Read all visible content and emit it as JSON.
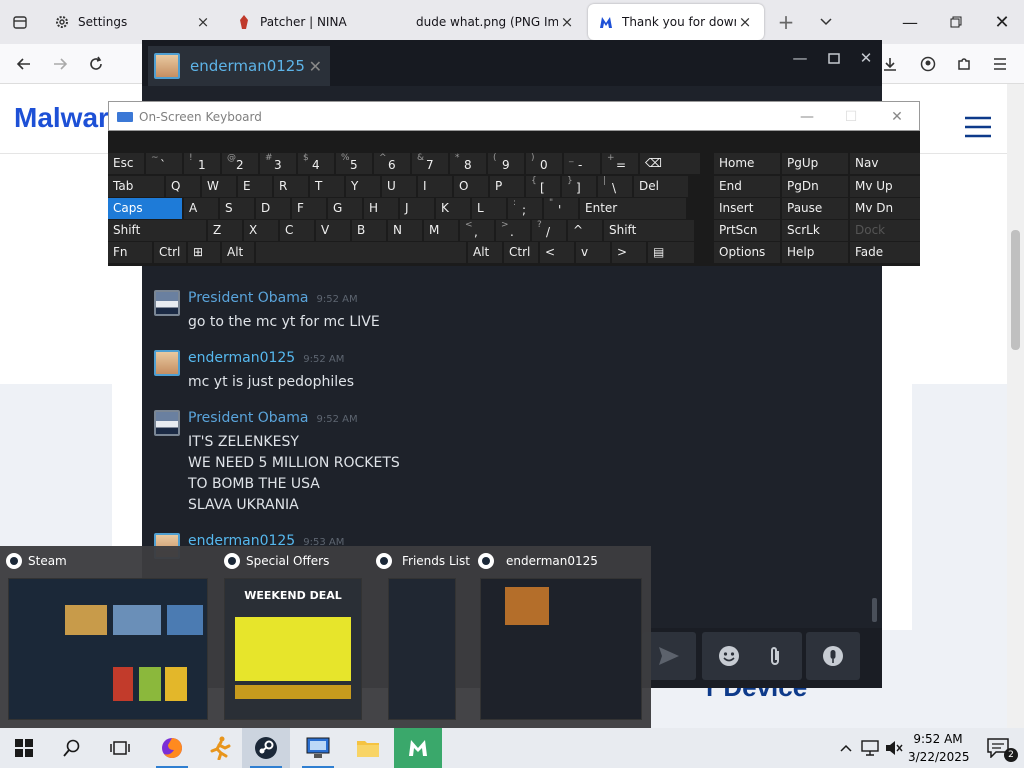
{
  "browser": {
    "tabs": [
      {
        "label": "Settings",
        "icon": "gear-icon"
      },
      {
        "label": "Patcher | NINA",
        "icon": "app-icon"
      },
      {
        "label": "dude what.png (PNG Imag",
        "icon": "image-icon"
      },
      {
        "label": "Thank you for downloa",
        "icon": "malwarebytes-icon"
      }
    ]
  },
  "website": {
    "logo_text": "Malwar",
    "device_heading": "r Device"
  },
  "steam_chat": {
    "tab_name": "enderman0125",
    "messages": [
      {
        "sender": "President Obama",
        "time": "9:52 AM",
        "lines": [
          "go to the mc yt for mc LIVE"
        ],
        "kind": "obama"
      },
      {
        "sender": "enderman0125",
        "time": "9:52 AM",
        "lines": [
          "mc yt is just pedophiles"
        ],
        "kind": "ender"
      },
      {
        "sender": "President Obama",
        "time": "9:52 AM",
        "lines": [
          "IT'S ZELENKESY",
          "WE NEED 5 MILLION ROCKETS",
          "TO BOMB THE USA",
          "SLAVA UKRANIA"
        ],
        "kind": "obama"
      },
      {
        "sender": "enderman0125",
        "time": "9:53 AM",
        "lines": [],
        "kind": "ender"
      }
    ]
  },
  "osk": {
    "title": "On-Screen Keyboard",
    "rows": [
      [
        [
          "Esc",
          ""
        ],
        [
          "`",
          "~"
        ],
        [
          "1",
          "!"
        ],
        [
          "2",
          "@"
        ],
        [
          "3",
          "#"
        ],
        [
          "4",
          "$"
        ],
        [
          "5",
          "%"
        ],
        [
          "6",
          "^"
        ],
        [
          "7",
          "&"
        ],
        [
          "8",
          "*"
        ],
        [
          "9",
          "("
        ],
        [
          "0",
          ")"
        ],
        [
          "-",
          "_"
        ],
        [
          "=",
          "+"
        ],
        [
          "⌫",
          ""
        ]
      ],
      [
        [
          "Tab",
          ""
        ],
        [
          "Q",
          ""
        ],
        [
          "W",
          ""
        ],
        [
          "E",
          ""
        ],
        [
          "R",
          ""
        ],
        [
          "T",
          ""
        ],
        [
          "Y",
          ""
        ],
        [
          "U",
          ""
        ],
        [
          "I",
          ""
        ],
        [
          "O",
          ""
        ],
        [
          "P",
          ""
        ],
        [
          "[",
          "{"
        ],
        [
          "]",
          "}"
        ],
        [
          "\\",
          "|"
        ],
        [
          "Del",
          ""
        ]
      ],
      [
        [
          "Caps",
          ""
        ],
        [
          "A",
          ""
        ],
        [
          "S",
          ""
        ],
        [
          "D",
          ""
        ],
        [
          "F",
          ""
        ],
        [
          "G",
          ""
        ],
        [
          "H",
          ""
        ],
        [
          "J",
          ""
        ],
        [
          "K",
          ""
        ],
        [
          "L",
          ""
        ],
        [
          ";",
          ":"
        ],
        [
          "'",
          "\""
        ],
        [
          "Enter",
          ""
        ]
      ],
      [
        [
          "Shift",
          ""
        ],
        [
          "Z",
          ""
        ],
        [
          "X",
          ""
        ],
        [
          "C",
          ""
        ],
        [
          "V",
          ""
        ],
        [
          "B",
          ""
        ],
        [
          "N",
          ""
        ],
        [
          "M",
          ""
        ],
        [
          ",",
          "<"
        ],
        [
          ".",
          ">"
        ],
        [
          "/",
          "?"
        ],
        [
          "^",
          ""
        ],
        [
          "Shift",
          ""
        ]
      ],
      [
        [
          "Fn",
          ""
        ],
        [
          "Ctrl",
          ""
        ],
        [
          "⊞",
          ""
        ],
        [
          "Alt",
          ""
        ],
        [
          "",
          ""
        ],
        [
          "Alt",
          ""
        ],
        [
          "Ctrl",
          ""
        ],
        [
          "<",
          ""
        ],
        [
          "v",
          ""
        ],
        [
          ">",
          ""
        ],
        [
          "▤",
          ""
        ]
      ]
    ],
    "nav_keys": [
      [
        "Home",
        "PgUp",
        "Nav"
      ],
      [
        "End",
        "PgDn",
        "Mv Up"
      ],
      [
        "Insert",
        "Pause",
        "Mv Dn"
      ],
      [
        "PrtScn",
        "ScrLk",
        "Dock"
      ],
      [
        "Options",
        "Help",
        "Fade"
      ]
    ]
  },
  "taskbar_preview": [
    {
      "title": "Steam"
    },
    {
      "title": "Special Offers",
      "thumb_text": "WEEKEND DEAL"
    },
    {
      "title": "Friends List"
    },
    {
      "title": "enderman0125"
    }
  ],
  "taskbar": {
    "time": "9:52 AM",
    "date": "3/22/2025",
    "notification_count": "2"
  }
}
